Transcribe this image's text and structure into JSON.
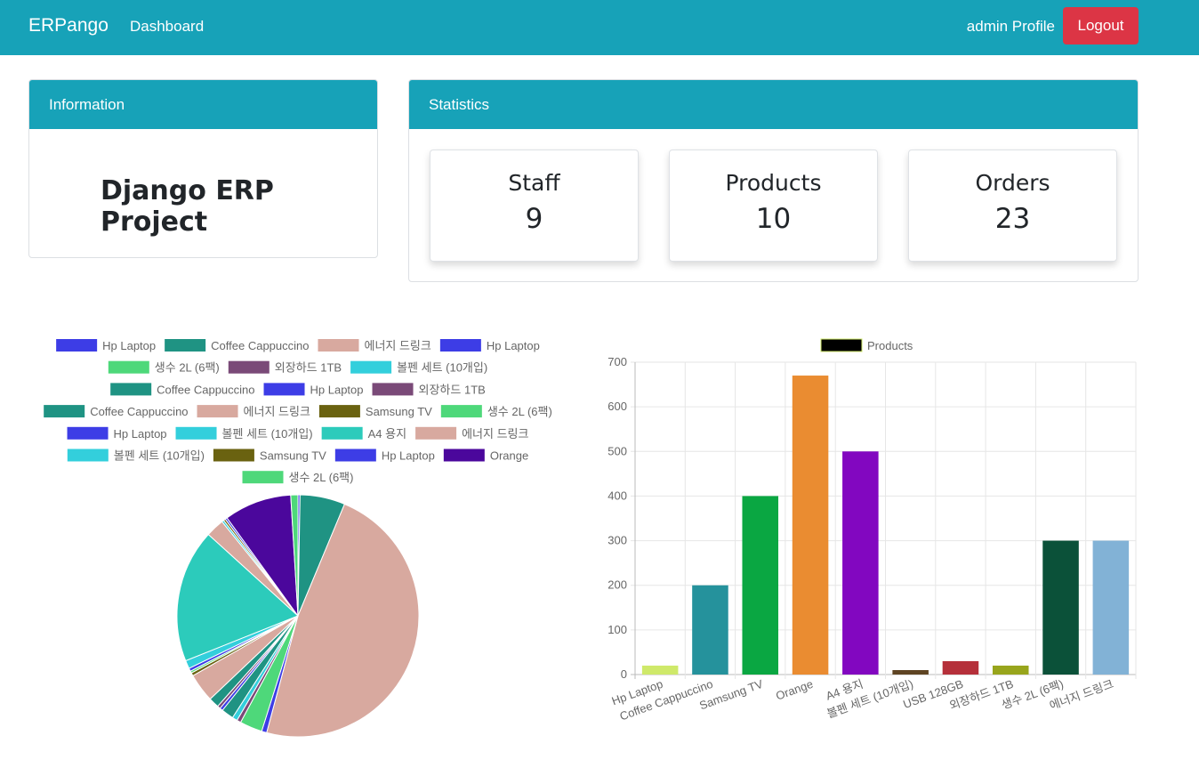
{
  "nav": {
    "brand": "ERPango",
    "dashboard": "Dashboard",
    "profile": "admin Profile",
    "logout": "Logout"
  },
  "info": {
    "header": "Information",
    "title": "Django ERP Project"
  },
  "stats": {
    "header": "Statistics",
    "items": [
      {
        "label": "Staff",
        "value": "9"
      },
      {
        "label": "Products",
        "value": "10"
      },
      {
        "label": "Orders",
        "value": "23"
      }
    ]
  },
  "chart_data": [
    {
      "type": "pie",
      "legend_position": "top",
      "slices": [
        {
          "label": "Hp Laptop",
          "value": 2,
          "color": "#3d3de6"
        },
        {
          "label": "Coffee Cappuccino",
          "value": 44,
          "color": "#1f9383"
        },
        {
          "label": "에너지 드링크",
          "value": 350,
          "color": "#d8a99f"
        },
        {
          "label": "Hp Laptop",
          "value": 5,
          "color": "#3d3de6"
        },
        {
          "label": "생수 2L (6팩)",
          "value": 22,
          "color": "#4ed87a"
        },
        {
          "label": "외장하드 1TB",
          "value": 4,
          "color": "#7a4a78"
        },
        {
          "label": "볼펜 세트 (10개입)",
          "value": 5,
          "color": "#33cfdc"
        },
        {
          "label": "Coffee Cappuccino",
          "value": 12,
          "color": "#1f9383"
        },
        {
          "label": "Hp Laptop",
          "value": 3,
          "color": "#3d3de6"
        },
        {
          "label": "외장하드 1TB",
          "value": 3,
          "color": "#7a4a78"
        },
        {
          "label": "Coffee Cappuccino",
          "value": 10,
          "color": "#1f9383"
        },
        {
          "label": "에너지 드링크",
          "value": 28,
          "color": "#d8a99f"
        },
        {
          "label": "Samsung TV",
          "value": 3,
          "color": "#6a6210"
        },
        {
          "label": "생수 2L (6팩)",
          "value": 2,
          "color": "#4ed87a"
        },
        {
          "label": "Hp Laptop",
          "value": 3,
          "color": "#3d3de6"
        },
        {
          "label": "볼펜 세트 (10개입)",
          "value": 8,
          "color": "#33cfdc"
        },
        {
          "label": "A4 용지",
          "value": 130,
          "color": "#2ccbbb"
        },
        {
          "label": "에너지 드링크",
          "value": 18,
          "color": "#d8a99f"
        },
        {
          "label": "볼펜 세트 (10개입)",
          "value": 2,
          "color": "#33cfdc"
        },
        {
          "label": "Samsung TV",
          "value": 2,
          "color": "#6a6210"
        },
        {
          "label": "Hp Laptop",
          "value": 2,
          "color": "#3d3de6"
        },
        {
          "label": "Orange",
          "value": 66,
          "color": "#4b079c"
        },
        {
          "label": "생수 2L (6팩)",
          "value": 7,
          "color": "#4ed87a"
        }
      ]
    },
    {
      "type": "bar",
      "series": [
        {
          "name": "Products",
          "color": "#cfe96a"
        }
      ],
      "categories": [
        "Hp Laptop",
        "Coffee Cappuccino",
        "Samsung TV",
        "Orange",
        "A4 용지",
        "볼펜 세트 (10개입)",
        "USB 128GB",
        "외장하드 1TB",
        "생수 2L (6팩)",
        "에너지 드링크"
      ],
      "values": [
        20,
        200,
        400,
        670,
        500,
        10,
        30,
        20,
        300,
        300
      ],
      "colors": [
        "#cfe96a",
        "#25929c",
        "#0aa742",
        "#ea8c31",
        "#8207c0",
        "#5e4423",
        "#b5303a",
        "#98a51c",
        "#0b5139",
        "#82b2d6"
      ],
      "ylim": [
        0,
        700
      ],
      "yticks": [
        0,
        100,
        200,
        300,
        400,
        500,
        600,
        700
      ],
      "grid": true,
      "legend_position": "top"
    }
  ]
}
